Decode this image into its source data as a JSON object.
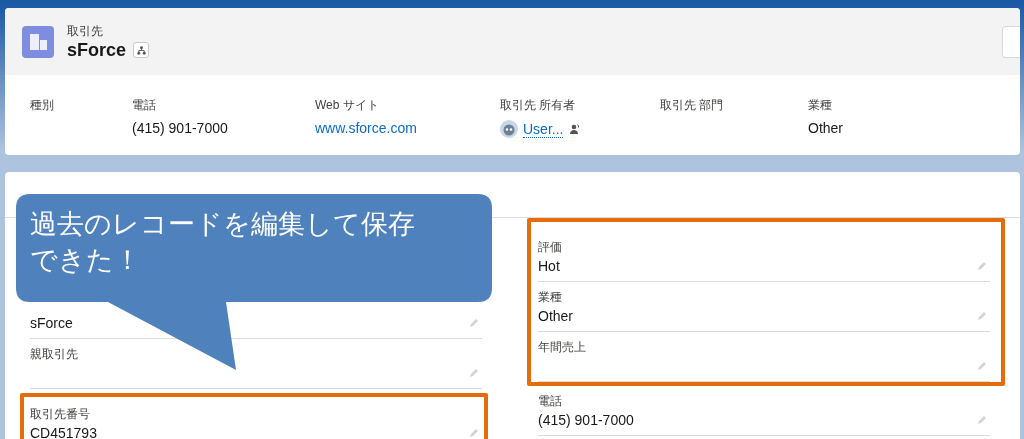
{
  "header": {
    "object_label": "取引先",
    "record_name": "sForce"
  },
  "highlights": [
    {
      "label": "種別"
    },
    {
      "label": "電話",
      "value": "(415) 901-7000",
      "kind": "text"
    },
    {
      "label": "Web サイト",
      "value": "www.sforce.com",
      "kind": "link"
    },
    {
      "label": "取引先 所有者",
      "value": "User...",
      "kind": "user"
    },
    {
      "label": "取引先 部門"
    },
    {
      "label": "業種",
      "value": "Other",
      "kind": "text"
    }
  ],
  "detail": {
    "left_fields": [
      {
        "value": "sForce",
        "highlighted": false
      },
      {
        "label": "親取引先",
        "highlighted": false
      },
      {
        "label": "取引先番号",
        "value": "CD451793",
        "highlighted": true
      }
    ],
    "right_fields": [
      {
        "label": "評価",
        "value": "Hot",
        "highlighted": true
      },
      {
        "label": "業種",
        "value": "Other",
        "highlighted": true
      },
      {
        "label": "年間売上",
        "highlighted": true
      },
      {
        "label": "電話",
        "value": "(415) 901-7000",
        "highlighted": false
      }
    ]
  },
  "callout": {
    "text": "過去のレコードを編集して保存できた！"
  }
}
